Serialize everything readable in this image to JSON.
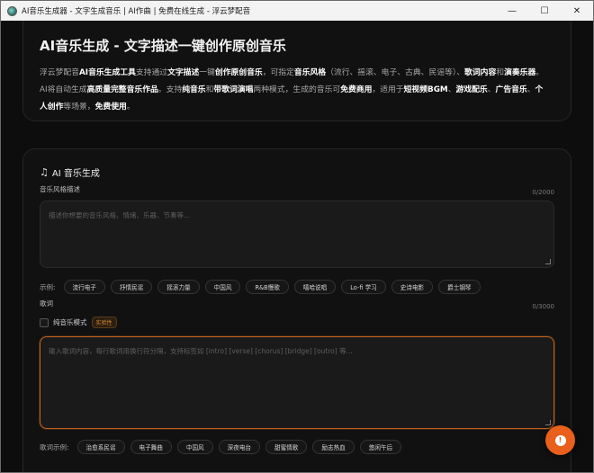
{
  "window": {
    "title": "AI音乐生成器 - 文字生成音乐 | AI作曲 | 免费在线生成 - 浮云梦配音",
    "minimize": "—",
    "maximize": "☐",
    "close": "✕"
  },
  "hero": {
    "title": "AI音乐生成 - 文字描述一键创作原创音乐",
    "intro": [
      {
        "t": "浮云梦配音",
        "b": false
      },
      {
        "t": "AI音乐生成工具",
        "b": true
      },
      {
        "t": "支持通过",
        "b": false
      },
      {
        "t": "文字描述",
        "b": true
      },
      {
        "t": "一键",
        "b": false
      },
      {
        "t": "创作原创音乐",
        "b": true
      },
      {
        "t": "，可指定",
        "b": false
      },
      {
        "t": "音乐风格",
        "b": true
      },
      {
        "t": "（流行、摇滚、电子、古典、民谣等）、",
        "b": false
      },
      {
        "t": "歌词内容",
        "b": true
      },
      {
        "t": "和",
        "b": false
      },
      {
        "t": "演奏乐器",
        "b": true
      },
      {
        "t": "。AI将自动生成",
        "b": false
      },
      {
        "t": "高质量完整音乐作品",
        "b": true
      },
      {
        "t": "。支持",
        "b": false
      },
      {
        "t": "纯音乐",
        "b": true
      },
      {
        "t": "和",
        "b": false
      },
      {
        "t": "带歌词演唱",
        "b": true
      },
      {
        "t": "两种模式，生成的音乐可",
        "b": false
      },
      {
        "t": "免费商用",
        "b": true
      },
      {
        "t": "，适用于",
        "b": false
      },
      {
        "t": "短视频BGM",
        "b": true
      },
      {
        "t": "、",
        "b": false
      },
      {
        "t": "游戏配乐",
        "b": true
      },
      {
        "t": "、",
        "b": false
      },
      {
        "t": "广告音乐",
        "b": true
      },
      {
        "t": "、",
        "b": false
      },
      {
        "t": "个人创作",
        "b": true
      },
      {
        "t": "等场景，",
        "b": false
      },
      {
        "t": "免费使用",
        "b": true
      },
      {
        "t": "。",
        "b": false
      }
    ]
  },
  "generator": {
    "title": "AI 音乐生成",
    "style": {
      "label": "音乐风格描述",
      "counter": "0/2000",
      "placeholder": "描述你想要的音乐风格、情绪、乐器、节奏等..."
    },
    "style_examples": {
      "label": "示例:",
      "chips": [
        "流行电子",
        "抒情民谣",
        "摇滚力量",
        "中国风",
        "R&B慢歌",
        "嘻哈说唱",
        "Lo-fi 学习",
        "史诗电影",
        "爵士钢琴"
      ]
    },
    "lyrics": {
      "label": "歌词",
      "counter": "0/3000",
      "instrumental_label": "纯音乐模式",
      "instrumental_badge": "实验性",
      "placeholder": "输入歌词内容，每行歌词用换行符分隔，支持标签如 [intro] [verse] [chorus] [bridge] [outro] 等..."
    },
    "lyrics_examples": {
      "label": "歌词示例:",
      "chips": [
        "治愈系民谣",
        "电子舞曲",
        "中国风",
        "深夜电台",
        "甜蜜情歌",
        "励志热血",
        "悠闲午后"
      ]
    }
  },
  "fab": {
    "glyph": "!"
  }
}
